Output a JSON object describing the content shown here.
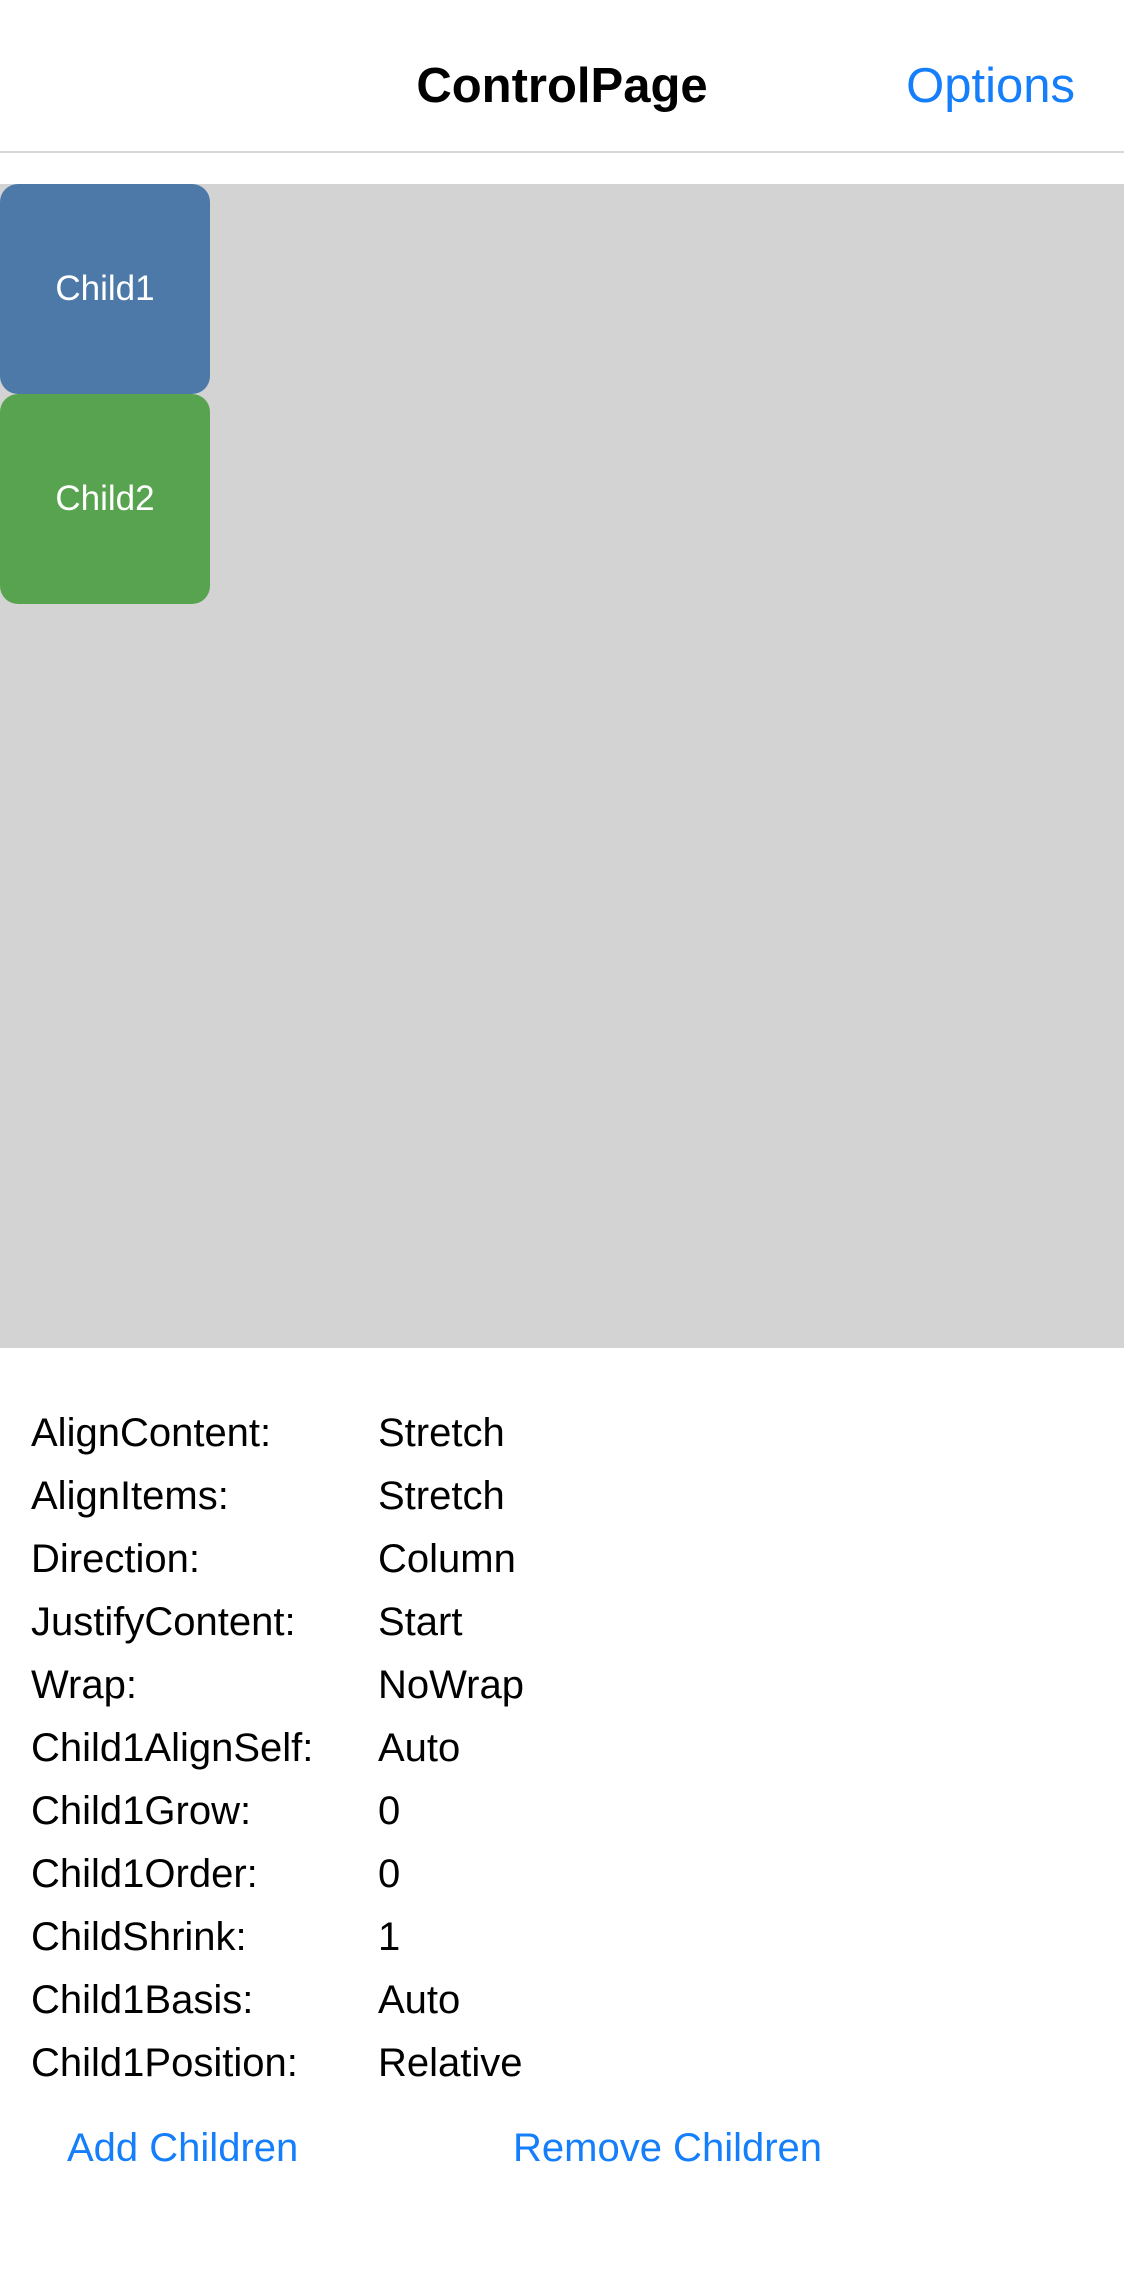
{
  "nav": {
    "title": "ControlPage",
    "options_label": "Options"
  },
  "colors": {
    "accent": "#147efb",
    "flex_background": "#d3d3d3",
    "child1": "#4c79a8",
    "child2": "#58a34f"
  },
  "children": [
    {
      "label": "Child1"
    },
    {
      "label": "Child2"
    }
  ],
  "properties": [
    {
      "label": "AlignContent:",
      "value": "Stretch"
    },
    {
      "label": "AlignItems:",
      "value": "Stretch"
    },
    {
      "label": "Direction:",
      "value": "Column"
    },
    {
      "label": "JustifyContent:",
      "value": "Start"
    },
    {
      "label": "Wrap:",
      "value": "NoWrap"
    },
    {
      "label": "Child1AlignSelf:",
      "value": "Auto"
    },
    {
      "label": "Child1Grow:",
      "value": "0"
    },
    {
      "label": "Child1Order:",
      "value": "0"
    },
    {
      "label": "ChildShrink:",
      "value": "1"
    },
    {
      "label": "Child1Basis:",
      "value": "Auto"
    },
    {
      "label": "Child1Position:",
      "value": "Relative"
    }
  ],
  "actions": {
    "add_label": "Add Children",
    "remove_label": "Remove Children"
  }
}
